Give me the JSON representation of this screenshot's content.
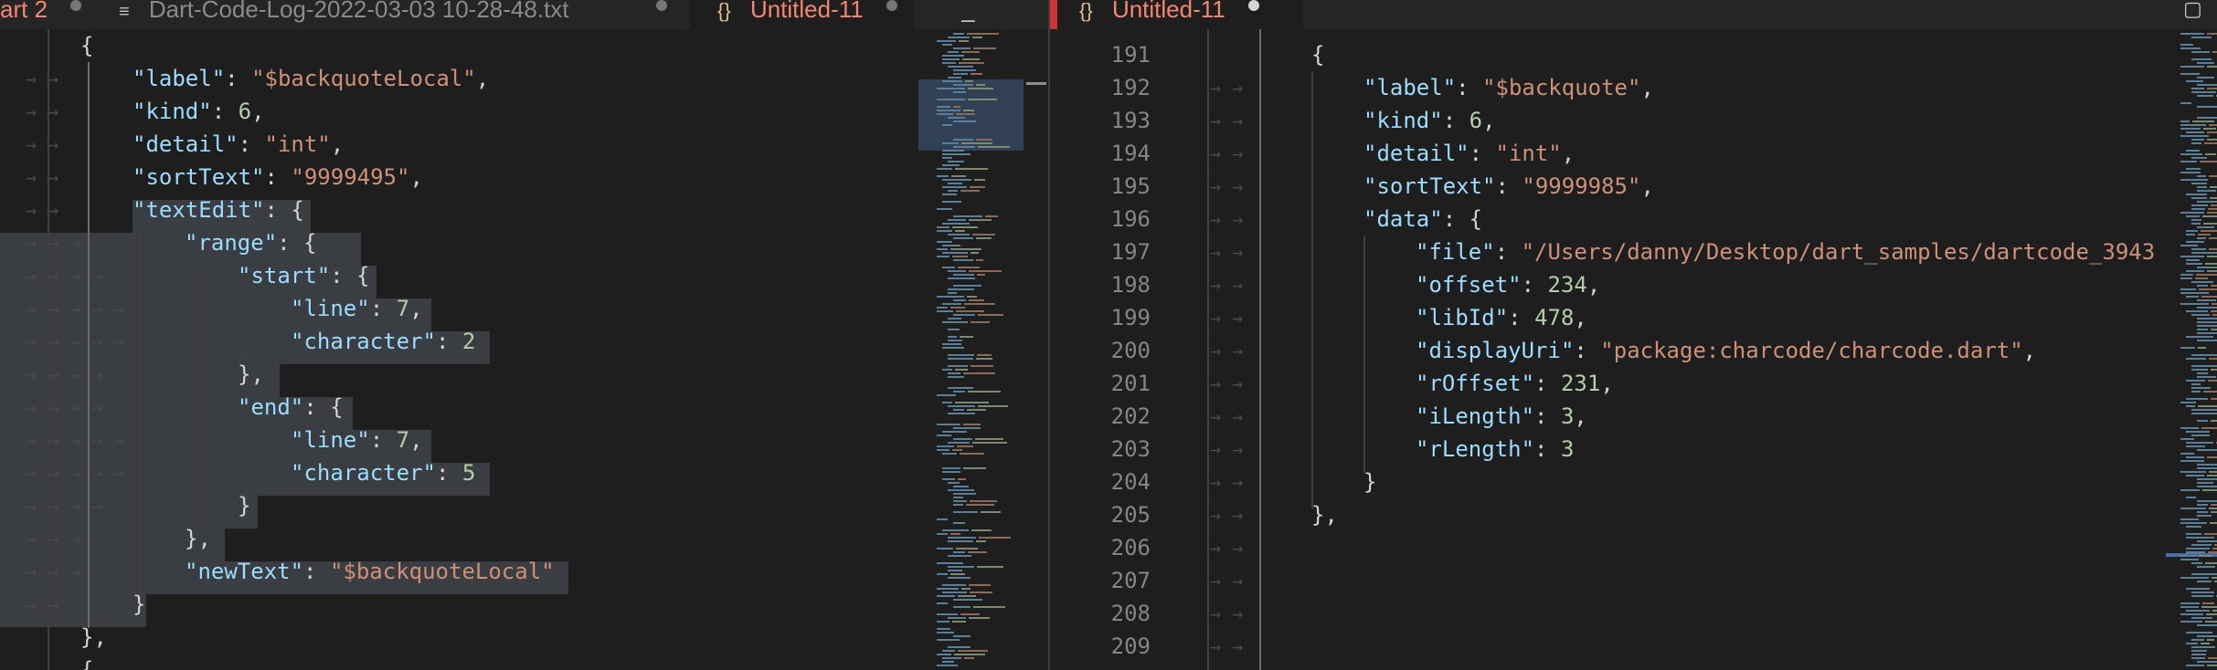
{
  "left_tabs": [
    {
      "label": "art 2",
      "icon": "",
      "dirty": true,
      "active": false,
      "error": true
    },
    {
      "label": "Dart-Code-Log-2022-03-03 10-28-48.txt",
      "icon": "≡",
      "dirty": true,
      "active": false,
      "error": false
    },
    {
      "label": "Untitled-11",
      "icon": "{}",
      "dirty": true,
      "active": true,
      "error": true
    }
  ],
  "right_tabs": [
    {
      "label": "Untitled-11",
      "icon": "{}",
      "dirty": true,
      "active": true,
      "error": true
    }
  ],
  "left_editor": {
    "lines": [
      "{",
      "\"label\": \"$backquoteLocal\",",
      "\"kind\": 6,",
      "\"detail\": \"int\",",
      "\"sortText\": \"9999495\",",
      "\"textEdit\": {",
      "\"range\": {",
      "\"start\": {",
      "\"line\": 7,",
      "\"character\": 2",
      "},",
      "\"end\": {",
      "\"line\": 7,",
      "\"character\": 5",
      "}",
      "},",
      "\"newText\": \"$backquoteLocal\"",
      "}",
      "},",
      "{"
    ]
  },
  "right_editor": {
    "line_numbers": [
      "191",
      "192",
      "193",
      "194",
      "195",
      "196",
      "197",
      "198",
      "199",
      "200",
      "201",
      "202",
      "203",
      "204",
      "205",
      "206",
      "207",
      "208",
      "209"
    ],
    "lines": [
      "{",
      "\"label\": \"$backquote\",",
      "\"kind\": 6,",
      "\"detail\": \"int\",",
      "\"sortText\": \"9999985\",",
      "\"data\": {",
      "\"file\": \"/Users/danny/Desktop/dart_samples/dartcode_3943",
      "\"offset\": 234,",
      "\"libId\": 478,",
      "\"displayUri\": \"package:charcode/charcode.dart\",",
      "\"rOffset\": 231,",
      "\"iLength\": 3,",
      "\"rLength\": 3",
      "}",
      "},",
      "",
      "",
      "",
      ""
    ]
  },
  "colors": {
    "editor_bg": "#1e1e1e",
    "key": "#9cdcfe",
    "string": "#ce9178",
    "number": "#b5cea8",
    "selection": "#3a3d41",
    "line_number": "#858585"
  }
}
